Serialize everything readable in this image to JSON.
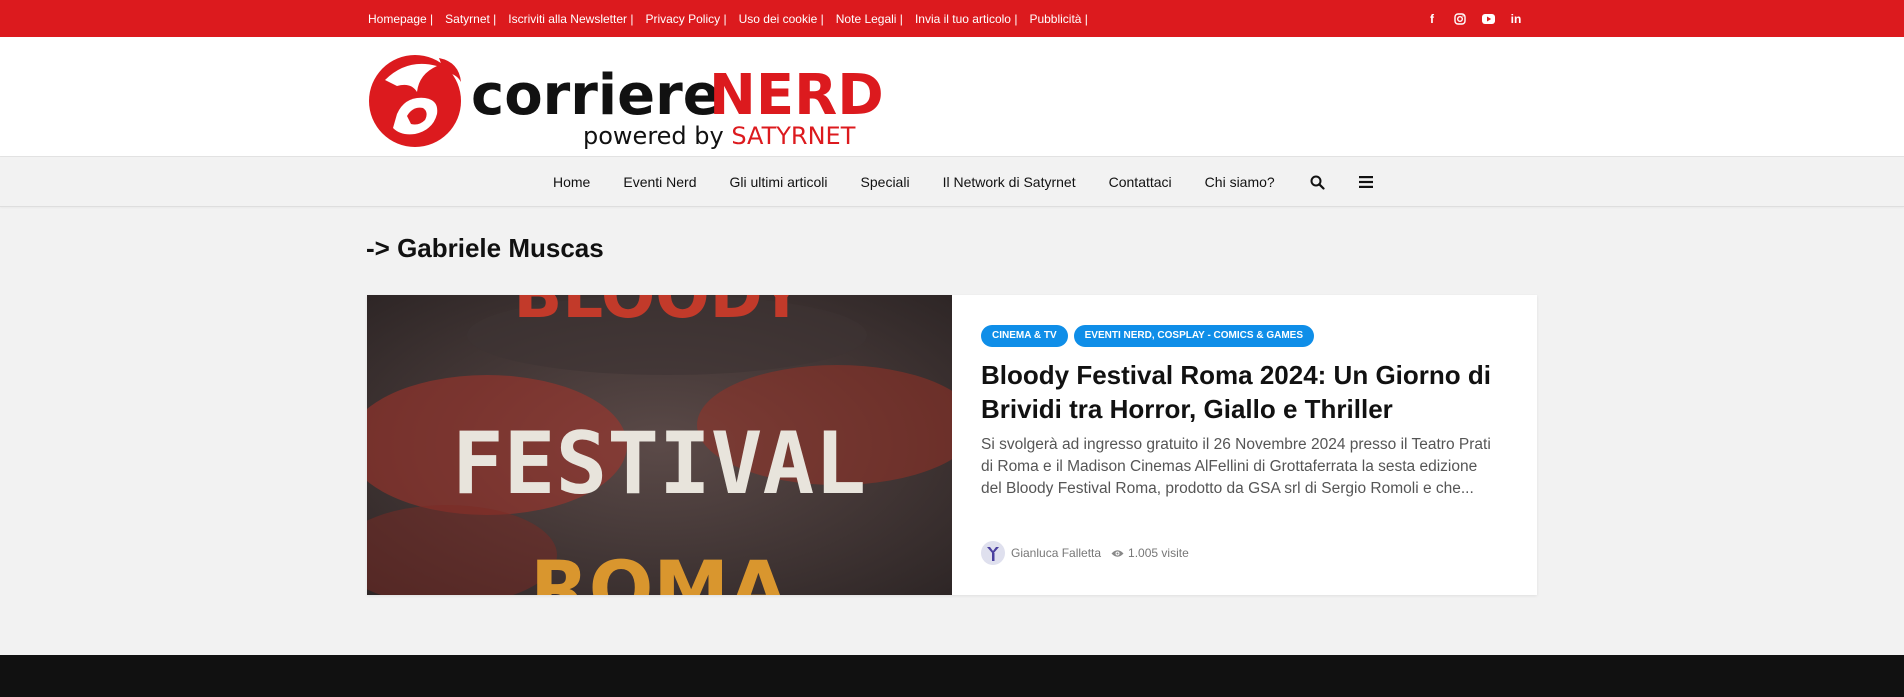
{
  "topbar": {
    "links": [
      "Homepage |",
      "Satyrnet |",
      "Iscriviti alla Newsletter |",
      "Privacy Policy |",
      "Uso dei cookie |",
      "Note Legali |",
      "Invia il tuo articolo |",
      "Pubblicità |"
    ],
    "social": {
      "facebook": "f",
      "instagram": "instagram-icon",
      "youtube": "youtube-icon",
      "linkedin": "in"
    }
  },
  "logo": {
    "text_main": "corriere",
    "text_accent": "NERD",
    "tagline_prefix": "powered by ",
    "tagline_brand": "SATYRNET"
  },
  "nav": {
    "items": [
      "Home",
      "Eventi Nerd",
      "Gli ultimi articoli",
      "Speciali",
      "Il Network di Satyrnet",
      "Contattaci",
      "Chi siamo?"
    ]
  },
  "archive": {
    "title": "-> Gabriele Muscas"
  },
  "post": {
    "image_text_top": "BLOODY",
    "image_text_main": "FESTIVAL",
    "image_text_bottom": "ROMA",
    "categories": [
      "CINEMA & TV",
      "EVENTI NERD, COSPLAY - COMICS & GAMES"
    ],
    "title": "Bloody Festival Roma 2024: Un Giorno di Brividi tra Horror, Giallo e Thriller",
    "excerpt": "Si svolgerà ad ingresso gratuito il 26 Novembre 2024 presso il Teatro Prati di Roma e il Madison Cinemas AlFellini di Grottaferrata la sesta edizione del Bloody Festival Roma, prodotto da GSA srl di Sergio Romoli e che...",
    "author": "Gianluca Falletta",
    "views": "1.005 visite"
  },
  "colors": {
    "brand_red": "#dc1a1e",
    "badge_blue": "#0f8ee8",
    "footer": "#111111"
  }
}
